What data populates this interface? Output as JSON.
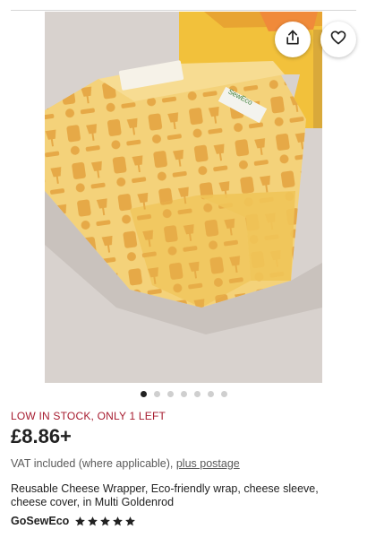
{
  "listing": {
    "stock_notice": "LOW IN STOCK, ONLY 1 LEFT",
    "price": "£8.86+",
    "vat_text": "VAT included (where applicable),",
    "postage_link": "plus postage",
    "title": "Reusable Cheese Wrapper, Eco-friendly wrap, cheese sleeve, cheese cover, in Multi Goldenrod",
    "shop_name": "GoSewEco",
    "rating": 5,
    "rating_max": 5,
    "photo_label_text": "SewEco"
  },
  "gallery": {
    "image_count": 7,
    "current_index": 0
  },
  "icons": {
    "share": "share-icon",
    "favorite": "heart-icon",
    "star": "star-icon"
  },
  "colors": {
    "stock_alert": "#a61a2e",
    "star": "#222222",
    "fabric": "#f3cf6f",
    "fabric_print": "#e3a23e"
  }
}
